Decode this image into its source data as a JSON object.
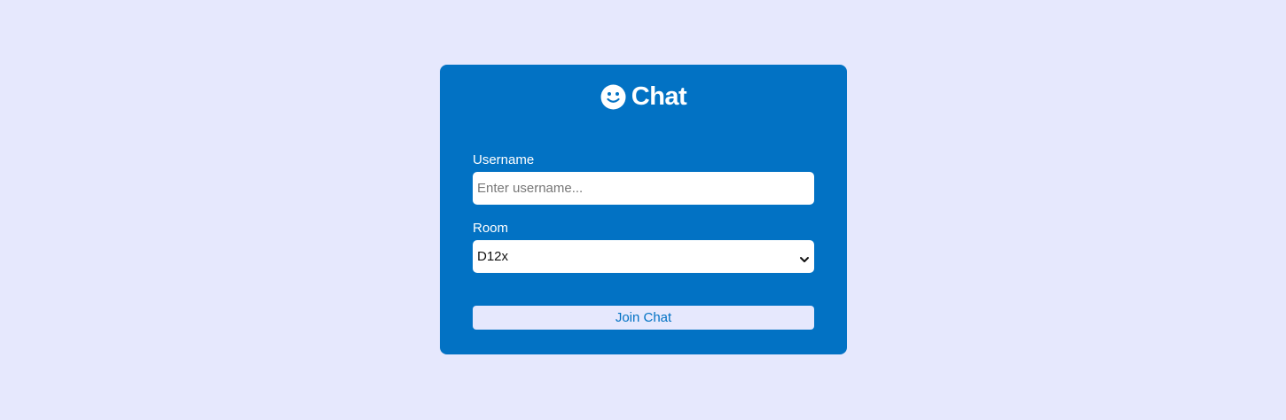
{
  "header": {
    "icon": "smile-icon",
    "title": "Chat"
  },
  "form": {
    "username_label": "Username",
    "username_placeholder": "Enter username...",
    "username_value": "",
    "room_label": "Room",
    "room_selected": "D12x",
    "join_label": "Join Chat"
  },
  "colors": {
    "background": "#e6e8fd",
    "card": "#0272c4",
    "button_bg": "#e6e8fd",
    "button_text": "#0272c4"
  }
}
